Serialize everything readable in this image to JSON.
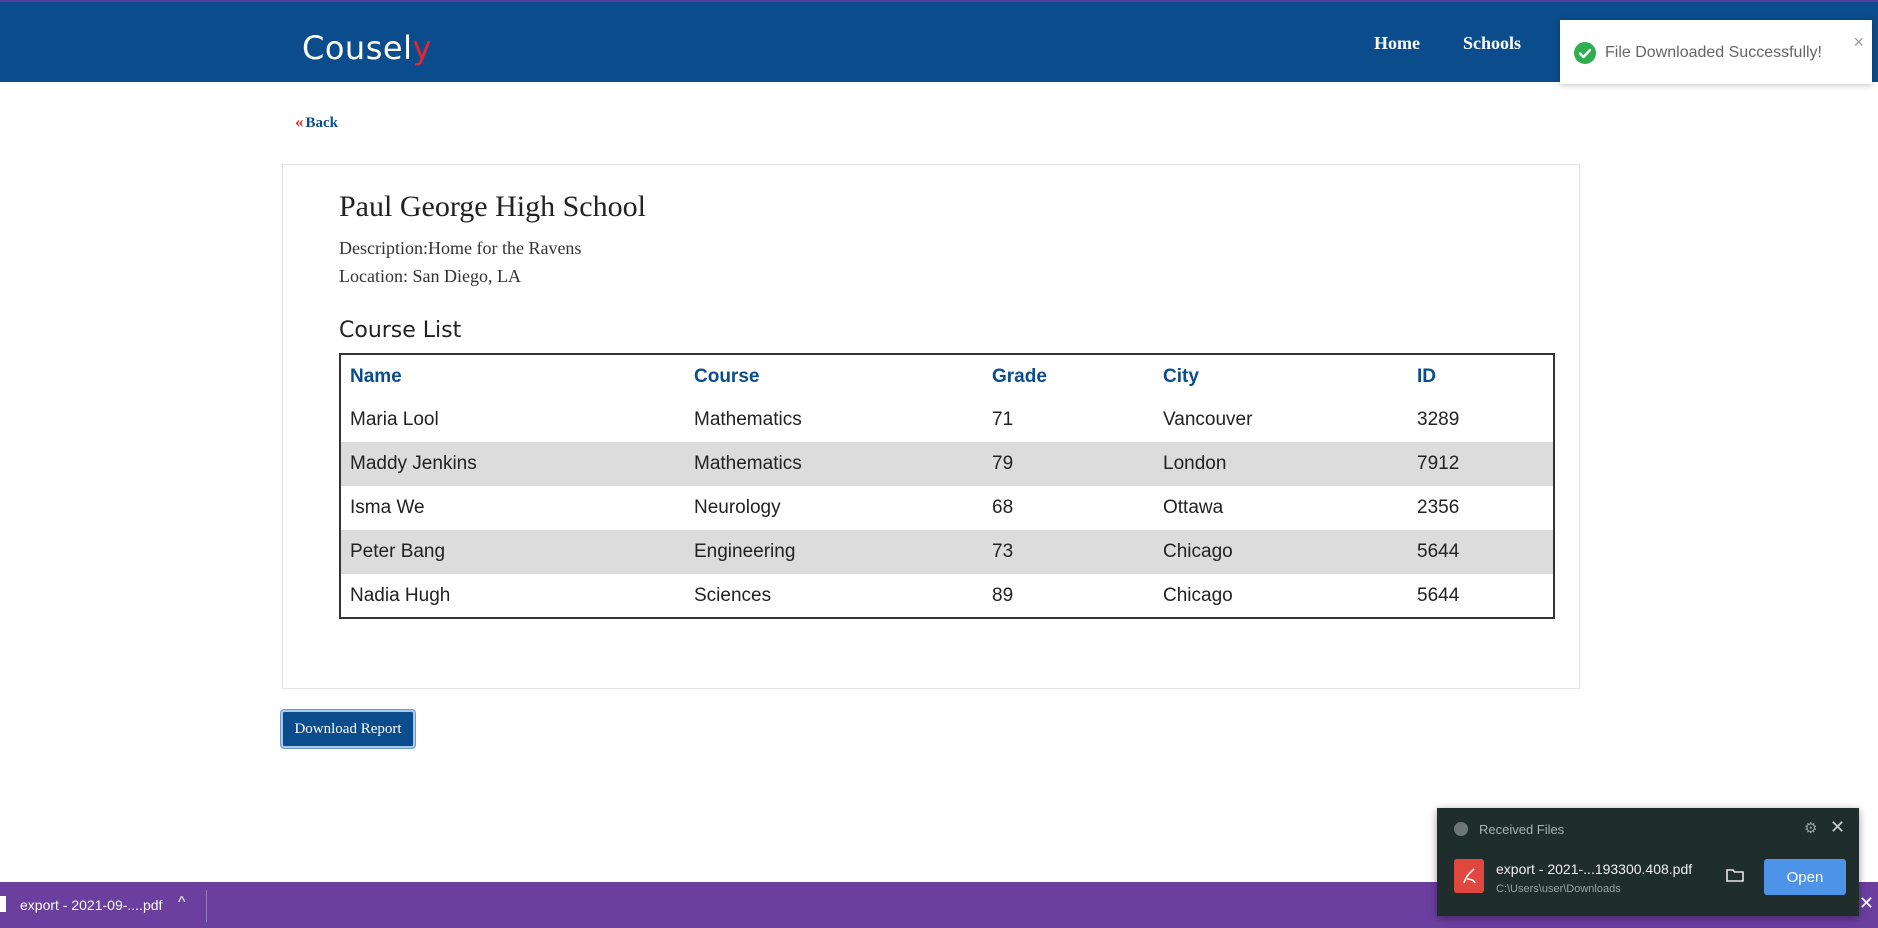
{
  "navbar": {
    "brand_main": "Cousel",
    "brand_accent": "y",
    "links": [
      "Home",
      "Schools"
    ]
  },
  "toast": {
    "message": "File Downloaded Successfully!",
    "close": "×",
    "status_color": "#2eae4f"
  },
  "back": {
    "chevron": "«",
    "label": "Back"
  },
  "school": {
    "title": "Paul George High School",
    "description": "Description:Home for the Ravens",
    "location": "Location: San Diego, LA"
  },
  "course_list": {
    "heading": "Course List",
    "columns": [
      "Name",
      "Course",
      "Grade",
      "City",
      "ID"
    ],
    "rows": [
      [
        "Maria Lool",
        "Mathematics",
        "71",
        "Vancouver",
        "3289"
      ],
      [
        "Maddy Jenkins",
        "Mathematics",
        "79",
        "London",
        "7912"
      ],
      [
        "Isma We",
        "Neurology",
        "68",
        "Ottawa",
        "2356"
      ],
      [
        "Peter Bang",
        "Engineering",
        "73",
        "Chicago",
        "5644"
      ],
      [
        "Nadia Hugh",
        "Sciences",
        "89",
        "Chicago",
        "5644"
      ]
    ]
  },
  "download_button": "Download Report",
  "download_bar": {
    "file": "export - 2021-09-....pdf",
    "chevron": "^",
    "close": "✕"
  },
  "received_files": {
    "header": "Received Files",
    "file_name": "export - 2021-...193300.408.pdf",
    "file_path": "C:\\Users\\user\\Downloads",
    "open_label": "Open",
    "close": "✕",
    "gear": "⚙"
  },
  "colors": {
    "brand": "#0b4d8c",
    "accent": "#e5262a",
    "taskbar": "#6b3fa0"
  }
}
